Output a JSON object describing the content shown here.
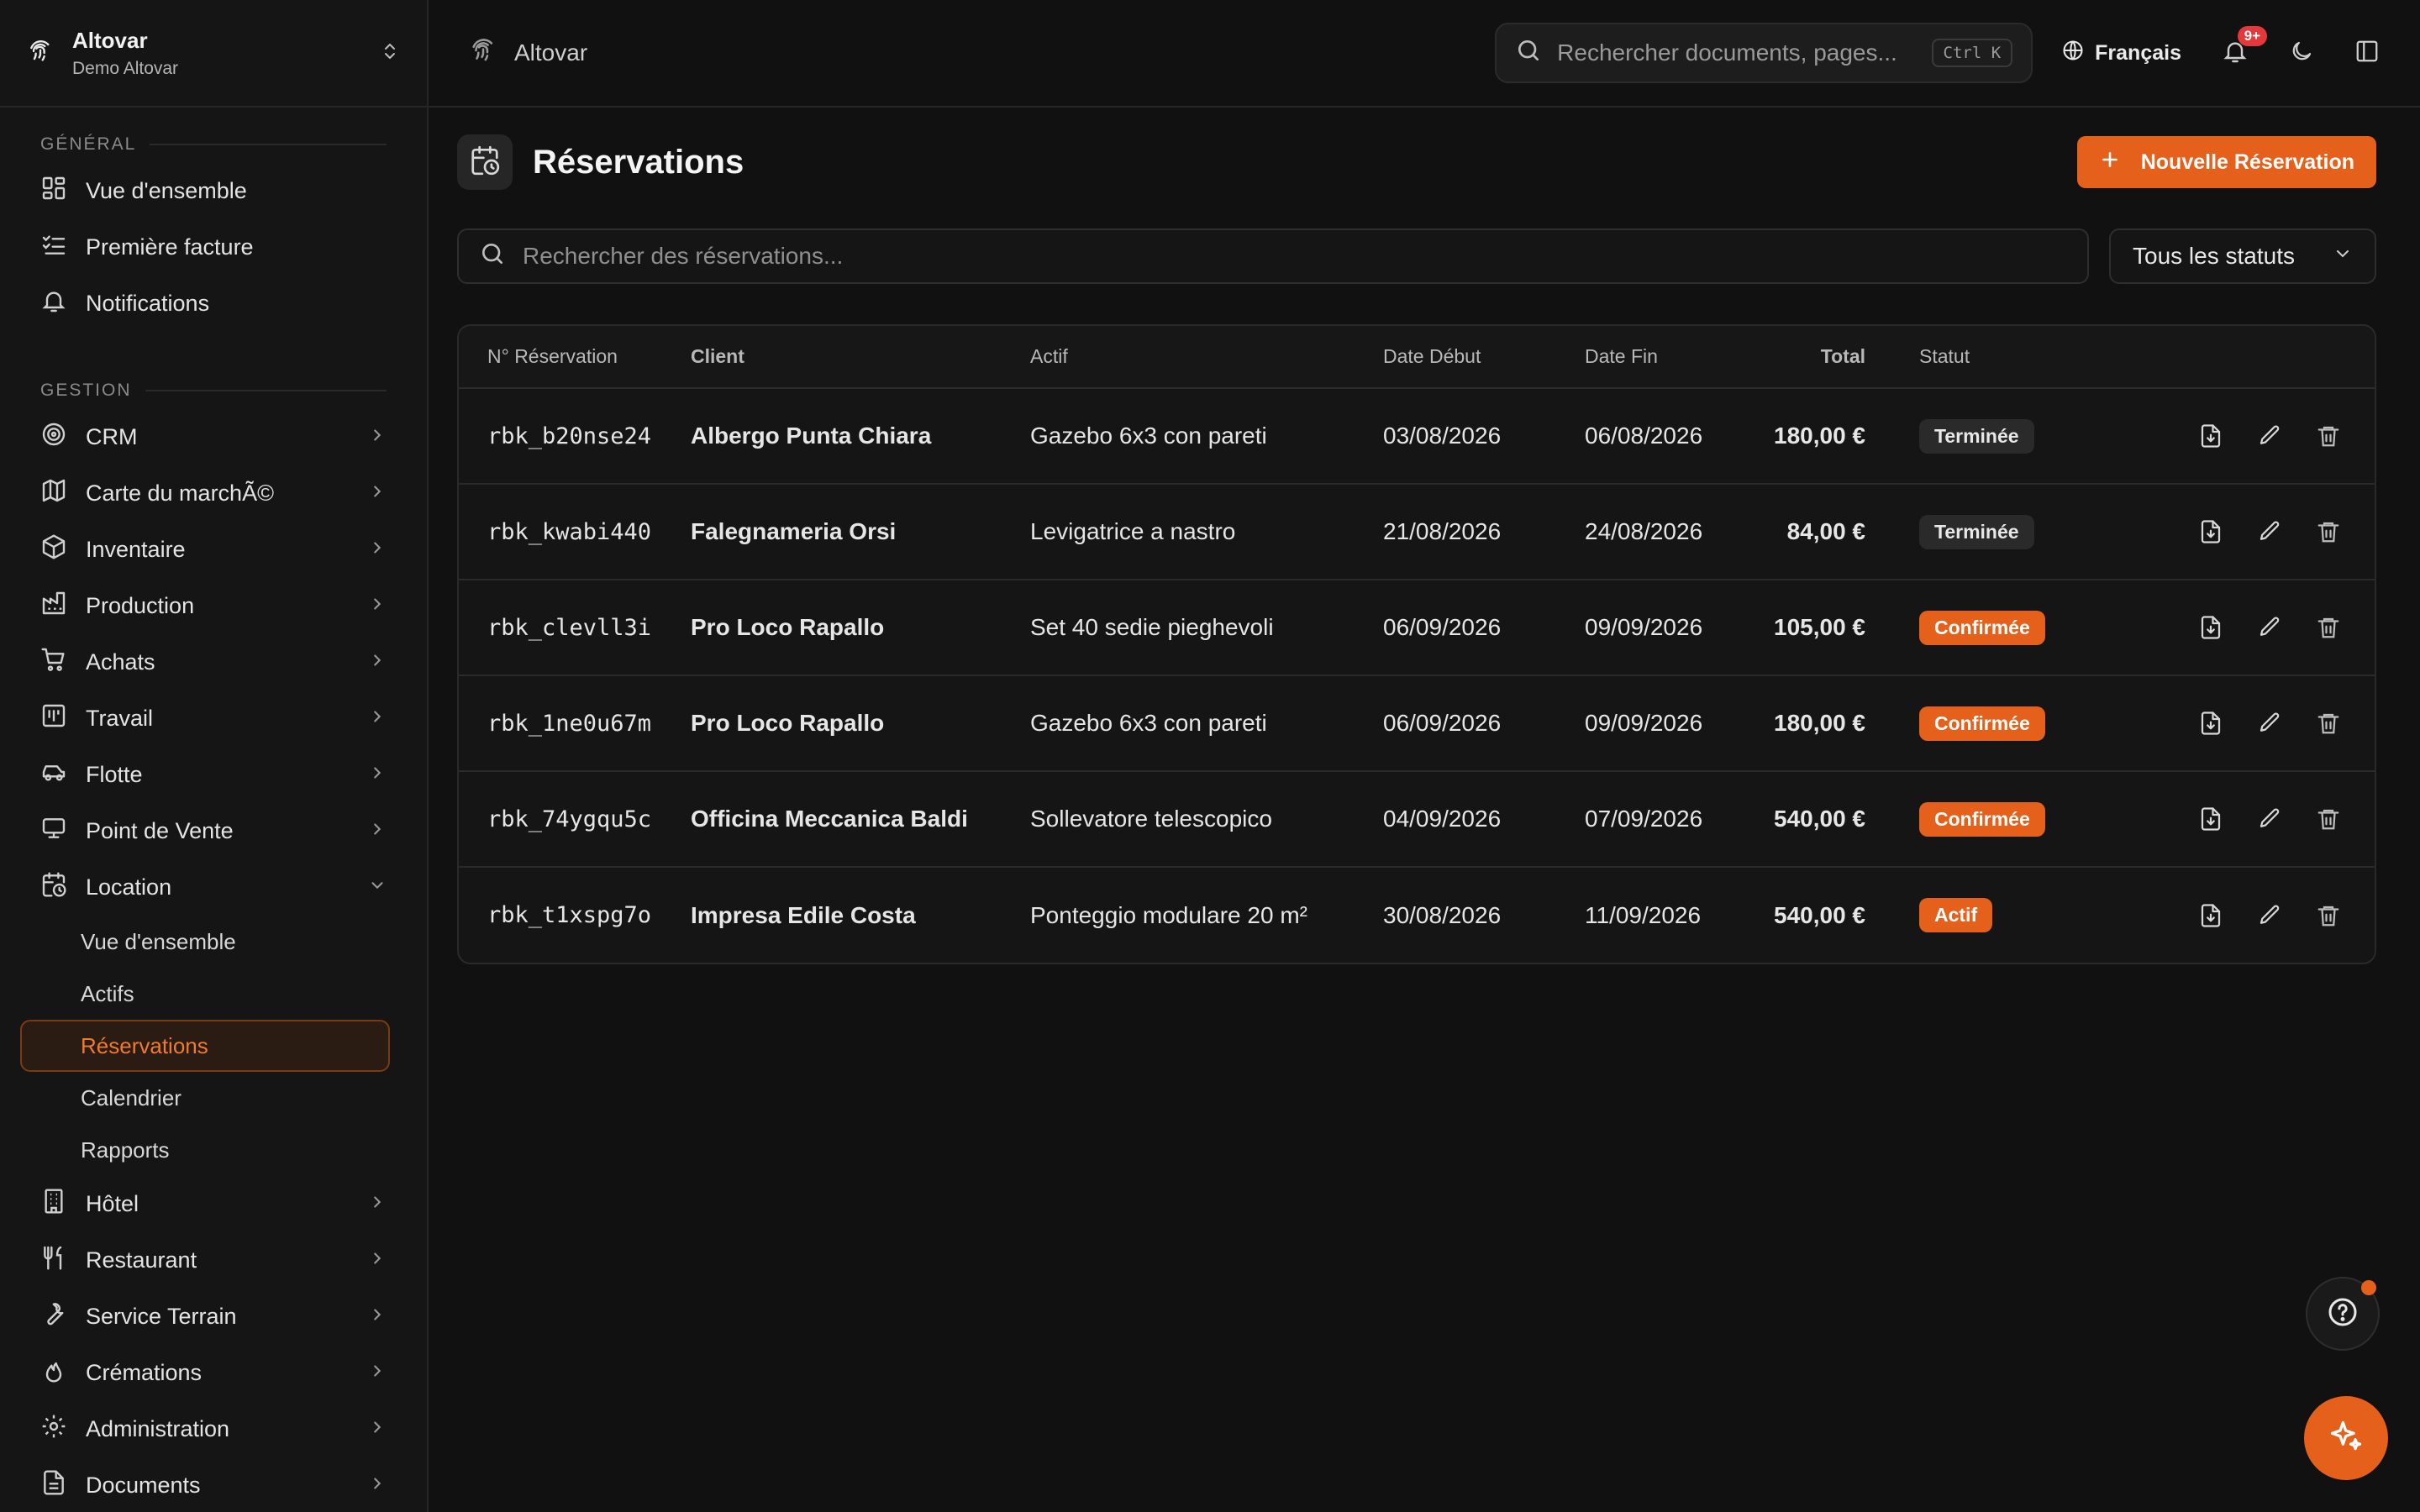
{
  "workspace": {
    "name": "Altovar",
    "subtitle": "Demo Altovar"
  },
  "topbar": {
    "breadcrumb": "Altovar",
    "search_placeholder": "Rechercher documents, pages...",
    "shortcut": "Ctrl K",
    "language": "Français",
    "notification_count": "9+"
  },
  "sidebar": {
    "section_general": "GÉNÉRAL",
    "general_items": [
      {
        "label": "Vue d'ensemble",
        "icon": "dashboard-icon"
      },
      {
        "label": "Première facture",
        "icon": "checklist-icon"
      },
      {
        "label": "Notifications",
        "icon": "bell-icon"
      }
    ],
    "section_gestion": "GESTION",
    "gestion_items": [
      {
        "label": "CRM",
        "icon": "target-icon"
      },
      {
        "label": "Carte du marchÃ©",
        "icon": "map-icon"
      },
      {
        "label": "Inventaire",
        "icon": "box-icon"
      },
      {
        "label": "Production",
        "icon": "factory-icon"
      },
      {
        "label": "Achats",
        "icon": "cart-icon"
      },
      {
        "label": "Travail",
        "icon": "kanban-icon"
      },
      {
        "label": "Flotte",
        "icon": "car-icon"
      },
      {
        "label": "Point de Vente",
        "icon": "monitor-icon"
      },
      {
        "label": "Location",
        "icon": "calendar-clock-icon"
      }
    ],
    "location_sub": [
      {
        "label": "Vue d'ensemble"
      },
      {
        "label": "Actifs"
      },
      {
        "label": "Réservations"
      },
      {
        "label": "Calendrier"
      },
      {
        "label": "Rapports"
      }
    ],
    "more_items": [
      {
        "label": "Hôtel",
        "icon": "building-icon"
      },
      {
        "label": "Restaurant",
        "icon": "utensils-icon"
      },
      {
        "label": "Service Terrain",
        "icon": "wrench-icon"
      },
      {
        "label": "Crémations",
        "icon": "flame-icon"
      },
      {
        "label": "Administration",
        "icon": "gear-icon"
      },
      {
        "label": "Documents",
        "icon": "document-icon"
      }
    ]
  },
  "page": {
    "title": "Réservations",
    "new_button": "Nouvelle Réservation",
    "search_placeholder": "Rechercher des réservations...",
    "status_filter": "Tous les statuts"
  },
  "table": {
    "headers": {
      "id": "N° Réservation",
      "client": "Client",
      "asset": "Actif",
      "start": "Date Début",
      "end": "Date Fin",
      "total": "Total",
      "status": "Statut"
    },
    "rows": [
      {
        "id": "rbk_b20nse24",
        "client": "Albergo Punta Chiara",
        "asset": "Gazebo 6x3 con pareti",
        "start": "03/08/2026",
        "end": "06/08/2026",
        "total": "180,00 €",
        "status": "Terminée",
        "status_kind": "done"
      },
      {
        "id": "rbk_kwabi440",
        "client": "Falegnameria Orsi",
        "asset": "Levigatrice a nastro",
        "start": "21/08/2026",
        "end": "24/08/2026",
        "total": "84,00 €",
        "status": "Terminée",
        "status_kind": "done"
      },
      {
        "id": "rbk_clevll3i",
        "client": "Pro Loco Rapallo",
        "asset": "Set 40 sedie pieghevoli",
        "start": "06/09/2026",
        "end": "09/09/2026",
        "total": "105,00 €",
        "status": "Confirmée",
        "status_kind": "conf"
      },
      {
        "id": "rbk_1ne0u67m",
        "client": "Pro Loco Rapallo",
        "asset": "Gazebo 6x3 con pareti",
        "start": "06/09/2026",
        "end": "09/09/2026",
        "total": "180,00 €",
        "status": "Confirmée",
        "status_kind": "conf"
      },
      {
        "id": "rbk_74ygqu5c",
        "client": "Officina Meccanica Baldi",
        "asset": "Sollevatore telescopico",
        "start": "04/09/2026",
        "end": "07/09/2026",
        "total": "540,00 €",
        "status": "Confirmée",
        "status_kind": "conf"
      },
      {
        "id": "rbk_t1xspg7o",
        "client": "Impresa Edile Costa",
        "asset": "Ponteggio modulare 20 m²",
        "start": "30/08/2026",
        "end": "11/09/2026",
        "total": "540,00 €",
        "status": "Actif",
        "status_kind": "conf"
      }
    ]
  },
  "colors": {
    "accent": "#e5601a",
    "background": "#111111",
    "sidebar": "#151515"
  }
}
